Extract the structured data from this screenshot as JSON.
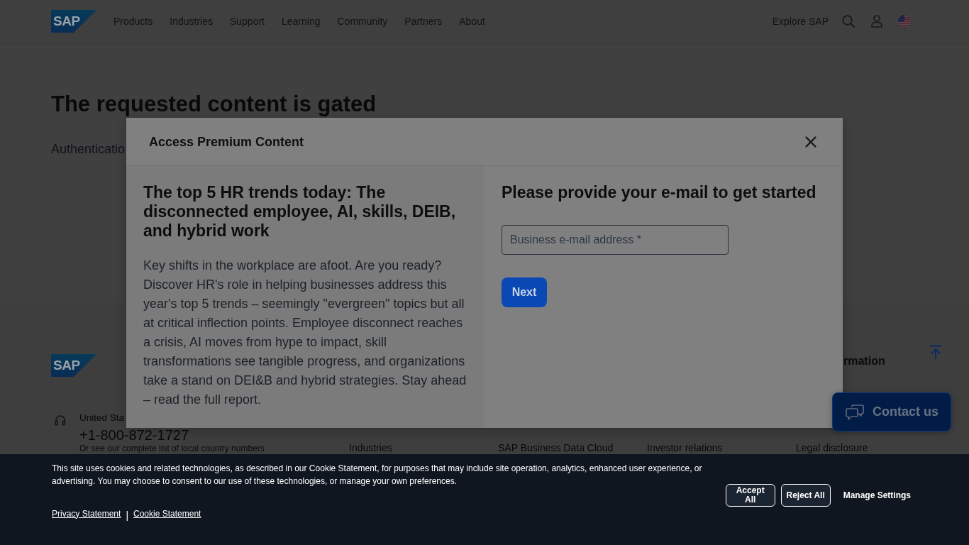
{
  "header": {
    "logo": "SAP",
    "nav": [
      "Products",
      "Industries",
      "Support",
      "Learning",
      "Community",
      "Partners",
      "About"
    ],
    "explore": "Explore SAP"
  },
  "page": {
    "title": "The requested content is gated",
    "subtitle": "Authenticatio"
  },
  "footer": {
    "logo": "SAP",
    "column_heading": "rmation",
    "phone_label": "United Sta",
    "phone": "+1-800-872-1727",
    "phone_note": "Or see our complete list of local country numbers",
    "links": [
      "Industries",
      "SAP Business Data Cloud",
      "Investor relations",
      "Legal disclosure"
    ]
  },
  "contact_button": {
    "label": "Contact us"
  },
  "modal": {
    "title": "Access Premium Content",
    "heading": "The top 5 HR trends today: The disconnected employee, AI, skills, DEIB, and hybrid work",
    "description": "Key shifts in the workplace are afoot. Are you ready? Discover HR's role in helping businesses address this year's top 5 trends – seemingly \"evergreen\" topics but all at critical inflection points. Employee disconnect reaches a crisis, AI moves from hype to impact, skill transformations see tangible progress, and organizations take a stand on DEI&B and hybrid strategies. Stay ahead – read the full report.",
    "form_heading": "Please provide your e-mail to get started",
    "email_field": {
      "placeholder": "Business e-mail address *"
    },
    "next_button": "Next"
  },
  "cookie_banner": {
    "text": "This site uses cookies and related technologies, as described in our Cookie Statement, for purposes that may include site operation, analytics, enhanced user experience, or advertising. You may choose to consent to our use of these technologies, or manage your own preferences.",
    "links": [
      "Privacy Statement",
      "Cookie Statement"
    ],
    "separator": "|",
    "buttons": [
      {
        "label": "Accept All",
        "kind": "outlined"
      },
      {
        "label": "Reject All",
        "kind": "outlined"
      },
      {
        "label": "Manage Settings",
        "kind": "text"
      }
    ]
  }
}
